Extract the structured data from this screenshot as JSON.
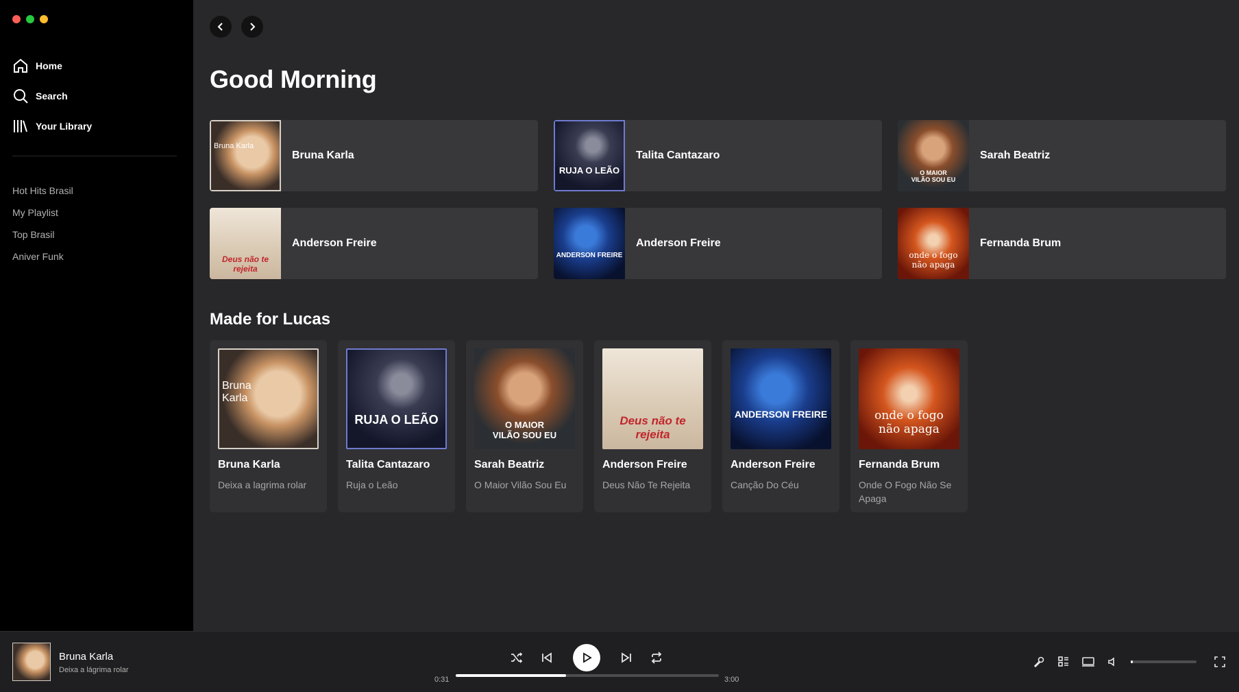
{
  "sidebar": {
    "nav": [
      {
        "label": "Home",
        "icon": "home-icon"
      },
      {
        "label": "Search",
        "icon": "search-icon"
      },
      {
        "label": "Your Library",
        "icon": "library-icon"
      }
    ],
    "playlists": [
      "Hot Hits Brasil",
      "My Playlist",
      "Top Brasil",
      "Aniver Funk"
    ]
  },
  "main": {
    "greeting": "Good Morning",
    "quick_items": [
      {
        "title": "Bruna Karla",
        "art": "art-a",
        "art_text": "Bruna Karla"
      },
      {
        "title": "Talita Cantazaro",
        "art": "art-b",
        "art_text": "RUJA O LEÃO"
      },
      {
        "title": "Sarah Beatriz",
        "art": "art-c",
        "art_text": "O MAIOR VILÃO SOU EU"
      },
      {
        "title": "Anderson Freire",
        "art": "art-d",
        "art_text": "Deus não te rejeita"
      },
      {
        "title": "Anderson Freire",
        "art": "art-e",
        "art_text": "ANDERSON FREIRE"
      },
      {
        "title": "Fernanda Brum",
        "art": "art-f",
        "art_text": "onde o fogo não apaga"
      }
    ],
    "section_title": "Made for Lucas",
    "cards": [
      {
        "title": "Bruna Karla",
        "subtitle": "Deixa a lagrima rolar",
        "art": "art-a",
        "art_text": "Bruna Karla"
      },
      {
        "title": "Talita Cantazaro",
        "subtitle": "Ruja o Leão",
        "art": "art-b",
        "art_text": "RUJA O LEÃO"
      },
      {
        "title": "Sarah Beatriz",
        "subtitle": "O Maior Vilão Sou Eu",
        "art": "art-c",
        "art_text": "O MAIOR VILÃO SOU EU"
      },
      {
        "title": "Anderson Freire",
        "subtitle": "Deus Não Te Rejeita",
        "art": "art-d",
        "art_text": "Deus não te rejeita"
      },
      {
        "title": "Anderson Freire",
        "subtitle": "Canção Do Céu",
        "art": "art-e",
        "art_text": "ANDERSON FREIRE"
      },
      {
        "title": "Fernanda Brum",
        "subtitle": "Onde O Fogo Não Se Apaga",
        "art": "art-f",
        "art_text": "onde o fogo não apaga"
      }
    ]
  },
  "player": {
    "track_title": "Bruna Karla",
    "track_subtitle": "Deixa a lágrima rolar",
    "elapsed": "0:31",
    "duration": "3:00",
    "progress_fraction": 0.42,
    "volume_fraction": 0.03
  },
  "colors": {
    "close": "#ff5f57",
    "minimize": "#28c840",
    "zoom": "#febc2e"
  }
}
